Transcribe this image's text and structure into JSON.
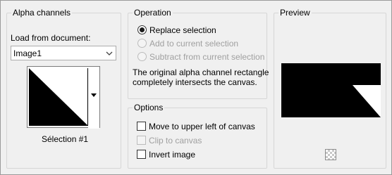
{
  "alpha_channels": {
    "title": "Alpha channels",
    "load_label": "Load from document:",
    "document_value": "Image1",
    "channel_name": "Sélection #1"
  },
  "operation": {
    "title": "Operation",
    "options": [
      {
        "label": "Replace selection",
        "selected": true,
        "enabled": true
      },
      {
        "label": "Add to current selection",
        "selected": false,
        "enabled": false
      },
      {
        "label": "Subtract from current selection",
        "selected": false,
        "enabled": false
      }
    ],
    "description_line1": "The original alpha channel rectangle",
    "description_line2": "completely intersects the canvas."
  },
  "options": {
    "title": "Options",
    "checkboxes": [
      {
        "label": "Move to upper left of canvas",
        "checked": false,
        "enabled": true
      },
      {
        "label": "Clip to canvas",
        "checked": false,
        "enabled": false
      },
      {
        "label": "Invert image",
        "checked": false,
        "enabled": true
      }
    ]
  },
  "preview": {
    "title": "Preview",
    "background_icon": "transparency-checker-icon"
  },
  "colors": {
    "window_bg": "#f0f0f0",
    "group_border": "#d6d6d6",
    "disabled_text": "#a0a0a0",
    "mask_black": "#000000",
    "mask_white": "#ffffff"
  }
}
